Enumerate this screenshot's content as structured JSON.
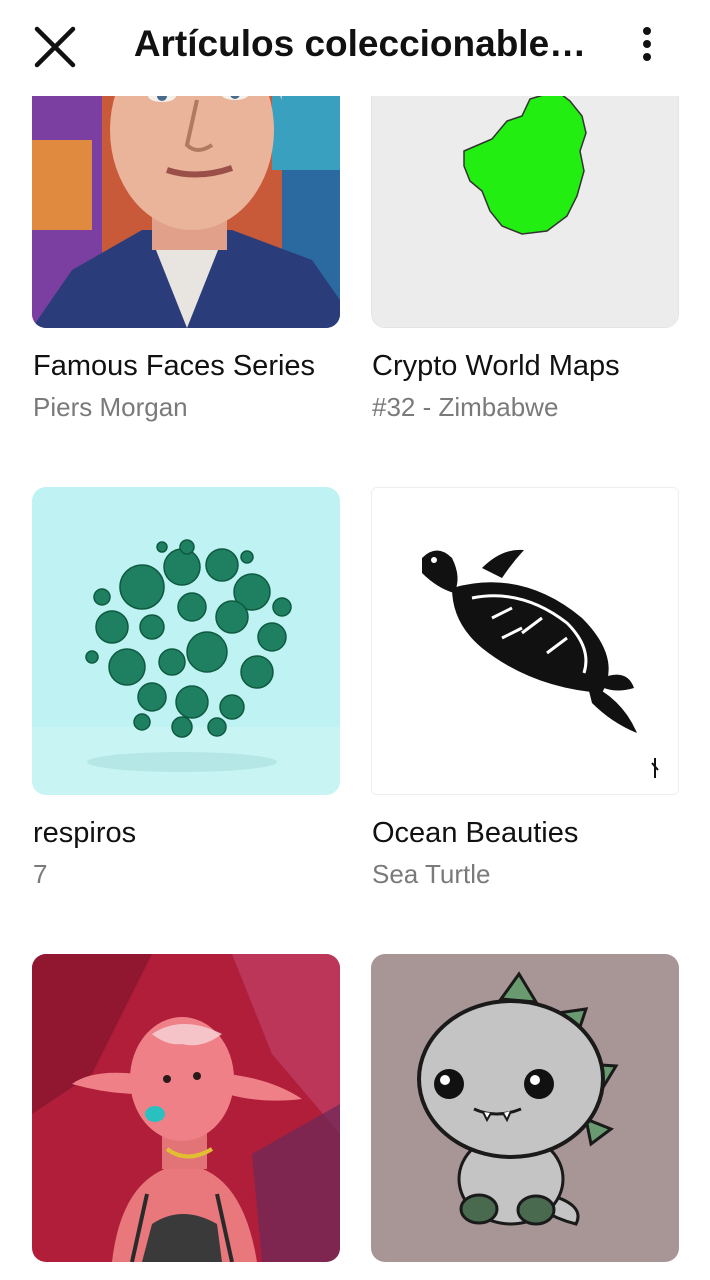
{
  "header": {
    "title": "Artículos coleccionable…",
    "close_icon": "close-icon",
    "more_icon": "more-vertical-icon"
  },
  "items": [
    {
      "title": "Famous Faces Series",
      "subtitle": "Piers Morgan",
      "image": "portrait-painting"
    },
    {
      "title": "Crypto World Maps",
      "subtitle": "#32 - Zimbabwe",
      "image": "green-country-map"
    },
    {
      "title": "respiros",
      "subtitle": "7",
      "image": "green-bubble-sphere"
    },
    {
      "title": "Ocean Beauties",
      "subtitle": "Sea Turtle",
      "image": "sea-turtle-drawing"
    },
    {
      "title": "",
      "subtitle": "",
      "image": "pink-elf-illustration"
    },
    {
      "title": "",
      "subtitle": "",
      "image": "baby-dinosaur-cartoon"
    }
  ]
}
